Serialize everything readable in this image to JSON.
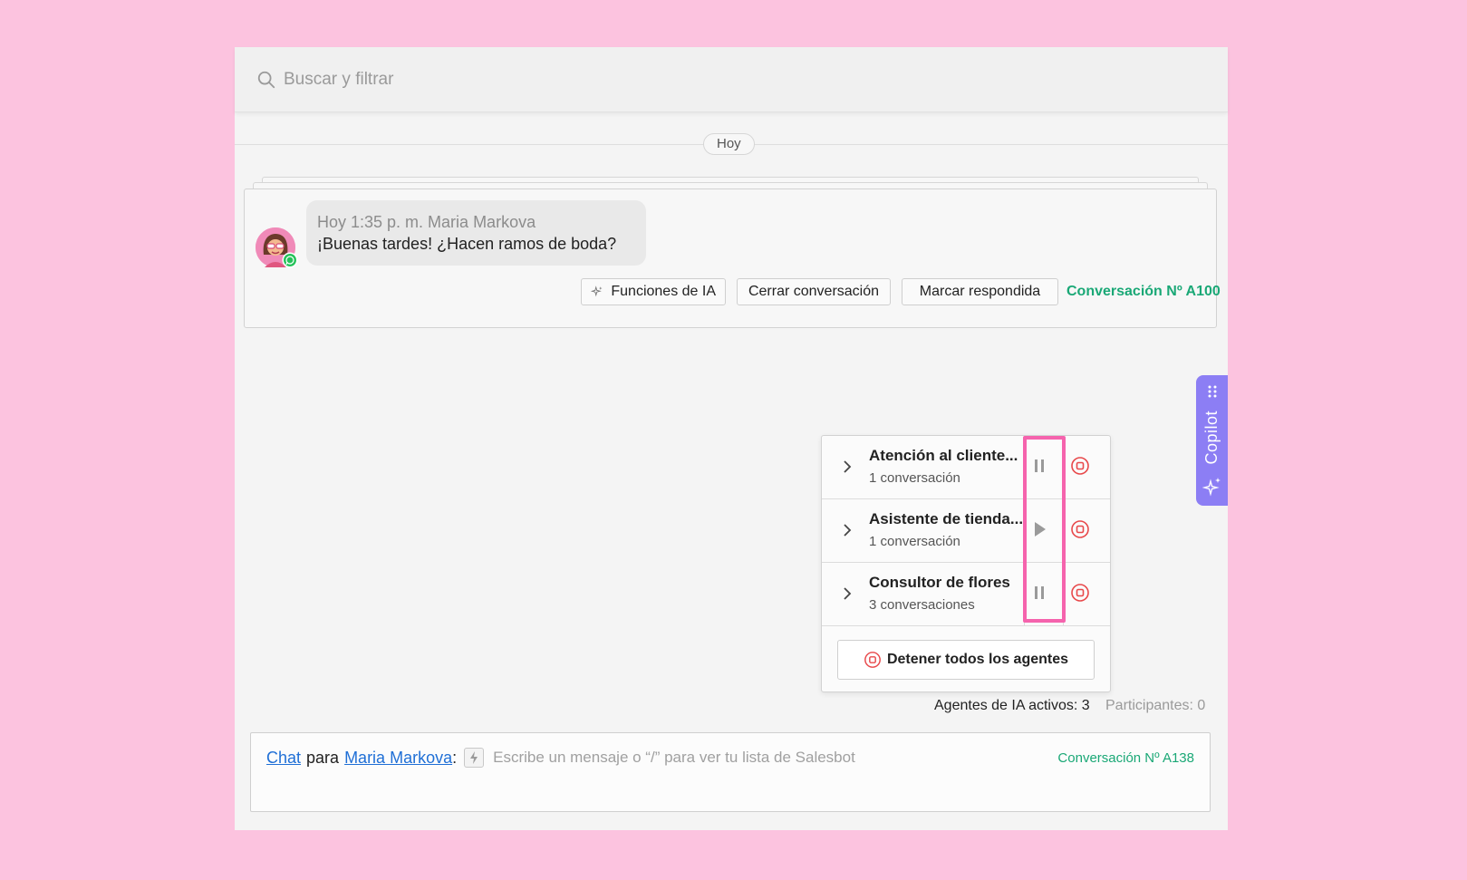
{
  "search": {
    "placeholder": "Buscar y filtrar"
  },
  "timeline": {
    "date_label": "Hoy"
  },
  "message": {
    "meta": "Hoy 1:35 p. m. Maria Markova",
    "text": "¡Buenas tardes! ¿Hacen ramos de boda?",
    "actions": {
      "ai_functions": "Funciones de IA",
      "close_conversation": "Cerrar conversación",
      "mark_answered": "Marcar respondida"
    },
    "conversation_label": "Conversación Nº A100"
  },
  "copilot": {
    "label": "Copilot"
  },
  "agents": {
    "items": [
      {
        "name": "Atención al cliente...",
        "count": "1 conversación",
        "state": "pause-icon"
      },
      {
        "name": "Asistente de tienda...",
        "count": "1 conversación",
        "state": "play-icon"
      },
      {
        "name": "Consultor de flores",
        "count": "3 conversaciones",
        "state": "pause-icon"
      }
    ],
    "stop_all_label": "Detener todos los agentes"
  },
  "status": {
    "active_agents": "Agentes de IA activos: 3",
    "participants": "Participantes: 0"
  },
  "composer": {
    "channel_link": "Chat",
    "connector": "para",
    "recipient_link": "Maria Markova",
    "colon": ":",
    "placeholder": "Escribe un mensaje o “/” para ver tu lista de Salesbot",
    "conversation_label": "Conversación Nº A138"
  },
  "colors": {
    "background": "#fcc3df",
    "accent_green": "#1aa876",
    "copilot_purple": "#8c7ef4",
    "highlight_pink": "#f563ad",
    "stop_red": "#e8494b",
    "link_blue": "#1f6fd6"
  }
}
